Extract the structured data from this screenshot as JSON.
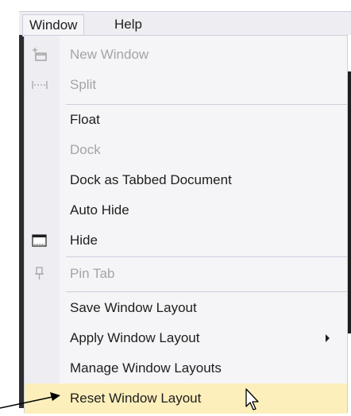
{
  "menubar": {
    "window_label": "Window",
    "help_label": "Help"
  },
  "menu": {
    "items": [
      {
        "label": "New Window",
        "disabled": true,
        "icon": "new-window-icon"
      },
      {
        "label": "Split",
        "disabled": true,
        "icon": "split-icon"
      },
      {
        "label": "Float",
        "disabled": false
      },
      {
        "label": "Dock",
        "disabled": true
      },
      {
        "label": "Dock as Tabbed Document",
        "disabled": false
      },
      {
        "label": "Auto Hide",
        "disabled": false
      },
      {
        "label": "Hide",
        "disabled": false,
        "icon": "hide-window-icon"
      },
      {
        "label": "Pin Tab",
        "disabled": true,
        "icon": "pin-icon"
      },
      {
        "label": "Save Window Layout",
        "disabled": false
      },
      {
        "label": "Apply Window Layout",
        "disabled": false,
        "submenu": true
      },
      {
        "label": "Manage Window Layouts",
        "disabled": false
      },
      {
        "label": "Reset Window Layout",
        "disabled": false,
        "highlighted": true
      }
    ]
  },
  "colors": {
    "menu_background": "#f5f5f7",
    "highlight": "#fcefbb",
    "disabled_text": "#a2a4a5",
    "text": "#1e1e1e"
  }
}
